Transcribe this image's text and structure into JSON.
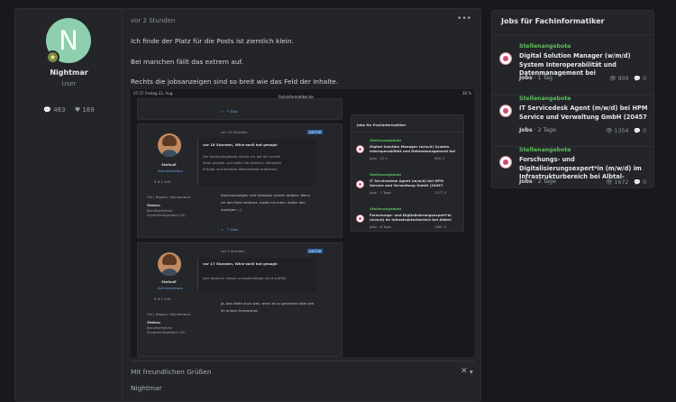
{
  "post": {
    "author": {
      "initial": "N",
      "name": "Nightmar",
      "role": "User",
      "comments_icon": "comment-icon",
      "comments": "483",
      "likes_icon": "heart-icon",
      "likes": "189"
    },
    "time": "vor 2 Stunden",
    "menu": "•••",
    "lines": [
      "Ich finde der Platz für die Posts ist ziemlich klein.",
      "Bei manchen fällt das extrem auf.",
      "Rechts die jobsanzeigen sind so breit wie das Feld der Inhalte."
    ],
    "screenshot": {
      "status_time": "07:27  Freitag 22. Aug.",
      "status_url": "fachinformatiker.de",
      "status_battery": "38 %",
      "reply_link": "Zitat",
      "cards": [
        {
          "time": "vor 15 Stunden",
          "badge": "AUTOR",
          "quote_head": "vor 18 Stunden, Whiz-zarD hat gesagt:",
          "quote_text": [
            "Die Stellenangebote würde ich auf die rechte",
            "Seite packen und dafür die Dateien, aktuellen",
            "Erfolge und beliebte Mitwirkende entfernen."
          ],
          "name": "StefanE",
          "role": "Administrators",
          "stats": "6 N   2   444",
          "location": "Ort | Region: Wonderland",
          "status_label": "Status:",
          "status_text": [
            "Berufserfahren",
            "Systemintegration (SI)"
          ],
          "body": [
            "Stellenanzeigen sind teilweise wieder drüben. Wenn",
            "ich den Rest entferne, bleibt nix mehr. Außer den",
            "Anzeigen ;-)"
          ]
        },
        {
          "time": "vor 2 Stunden",
          "badge": "AUTOR",
          "quote_head": "vor 17 Stunden, Whiz-zarD hat gesagt:",
          "quote_text": [
            "weil dadurch dieses unregelmäßige nicht auffällt"
          ],
          "name": "StefanE",
          "role": "Administrators",
          "stats": "6 N   2   444",
          "location": "Ort | Region: Wonderland",
          "status_label": "Status:",
          "status_text": [
            "Berufserfahren",
            "Systemintegration (SI)"
          ],
          "body": [
            "Ja, das hätte auch was, wenn es so geordnet wäre wie",
            "im ersten Screenshot."
          ]
        }
      ],
      "jobs_title": "Jobs für Fachinformatiker",
      "jobs": [
        {
          "cat": "Stellenangebote",
          "title": [
            "Digital Solution Manager (w/m/d) System",
            "Interoperabilität und Datenmanagement bei"
          ],
          "meta": "Jobs · 22 h",
          "stats": "905   0"
        },
        {
          "cat": "Stellenangebote",
          "title": [
            "IT Servicedesk Agent (m/w/d) bei HPM",
            "Service and Verwaltung GmbH (20457"
          ],
          "meta": "Jobs · 2 Tage",
          "stats": "1377   0"
        },
        {
          "cat": "Stellenangebote",
          "title": [
            "Forschungs- und Digitalisierungsexpert*in",
            "(m/w/d) im Infrastrukturbereich bei Albtal-"
          ],
          "meta": "Jobs · 6 Tage",
          "stats": "1667   0"
        }
      ]
    },
    "signature": {
      "greeting": "Mit freundlichen Grüßen",
      "name": "Nightmar",
      "close": "✕"
    }
  },
  "widget": {
    "title": "Jobs für Fachinformatiker",
    "jobs": [
      {
        "category": "Stellenangebote",
        "title": "Digital Solution Manager (w/m/d) System Interoperabilität und Datenmanagement bei",
        "source": "Jobs",
        "age": "1 Tag",
        "views": "909",
        "comments": "0"
      },
      {
        "category": "Stellenangebote",
        "title": "IT Servicedesk Agent (m/w/d) bei HPM Service und Verwaltung GmbH (20457",
        "source": "Jobs",
        "age": "2 Tage",
        "views": "1354",
        "comments": "0"
      },
      {
        "category": "Stellenangebote",
        "title": "Forschungs- und Digitalisierungsexpert*in (m/w/d) im Infrastrukturbereich bei Albtal-",
        "source": "Jobs",
        "age": "2 Tage",
        "views": "1672",
        "comments": "0"
      }
    ]
  }
}
